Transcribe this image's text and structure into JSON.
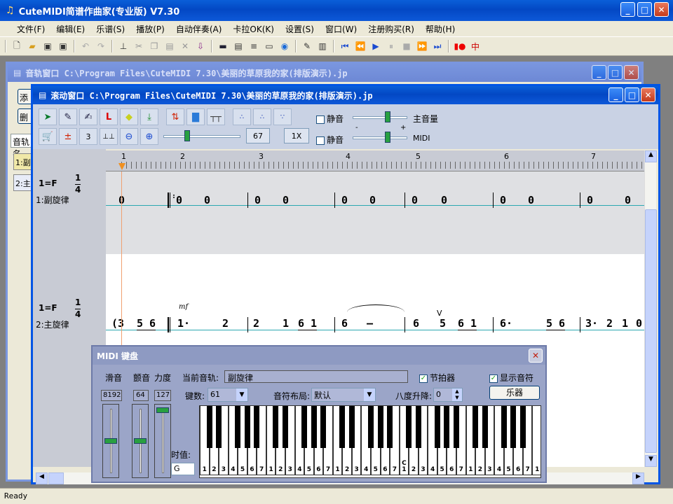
{
  "app": {
    "title": "CuteMIDI简谱作曲家(专业版) V7.30"
  },
  "menu": [
    "文件(F)",
    "编辑(E)",
    "乐谱(S)",
    "播放(P)",
    "自动伴奏(A)",
    "卡拉OK(K)",
    "设置(S)",
    "窗口(W)",
    "注册购买(R)",
    "帮助(H)"
  ],
  "track_window": {
    "title": "音轨窗口  C:\\Program Files\\CuteMIDI 7.30\\美丽的草原我的家(排版演示).jp",
    "tab": "音轨名",
    "buttons": [
      "添",
      "删"
    ],
    "tracks": [
      "1:副",
      "2:主"
    ]
  },
  "scroll_window": {
    "title": "滚动窗口  C:\\Program Files\\CuteMIDI 7.30\\美丽的草原我的家(排版演示).jp",
    "tool_value_3": "3",
    "tempo_value": "67",
    "speed_value": "1X",
    "mute1": "静音",
    "mute2": "静音",
    "master_volume": "主音量",
    "midi_label": "MIDI",
    "minus": "-",
    "plus": "+",
    "ruler": [
      "1",
      "2",
      "3",
      "4",
      "5",
      "6",
      "7"
    ],
    "track1": {
      "key": "1=F",
      "time_top": "1",
      "time_bottom": "4",
      "name": "1:副旋律",
      "notes": [
        "0",
        "0",
        "0",
        "0",
        "0",
        "0",
        "0",
        "0",
        "0",
        "0",
        "0",
        "0",
        "0"
      ]
    },
    "track2": {
      "key": "1=F",
      "time_top": "1",
      "time_bottom": "4",
      "name": "2:主旋律",
      "dynamic": "mf",
      "breath": "V",
      "notes": [
        "(3",
        "5 6",
        "1·",
        "2",
        "2",
        "1",
        "6 1",
        "6",
        "–",
        "6",
        "5",
        "6 1",
        "6·",
        "5 6",
        "3·",
        "2",
        "1",
        "0"
      ]
    }
  },
  "midi_keyboard": {
    "title": "MIDI 键盘",
    "slide_label": "滑音",
    "vibrato_label": "颤音",
    "force_label": "力度",
    "slide_value": "8192",
    "vibrato_value": "64",
    "force_value": "127",
    "current_track_label": "当前音轨:",
    "current_track_value": "副旋律",
    "metronome": "节拍器",
    "show_notes": "显示音符",
    "keys_label": "键数:",
    "keys_value": "61",
    "layout_label": "音符布局:",
    "layout_value": "默认",
    "octave_label": "八度升降:",
    "octave_value": "0",
    "instrument_button": "乐器",
    "duration_label": "时值:",
    "duration_value": "G",
    "key_labels": [
      "1",
      "2",
      "3",
      "4",
      "5",
      "6",
      "7",
      "1",
      "2",
      "3",
      "4",
      "5",
      "6",
      "7",
      "1",
      "2",
      "3",
      "4",
      "5",
      "6",
      "7",
      "C 1",
      "2",
      "3",
      "4",
      "5",
      "6",
      "7",
      "1",
      "2",
      "3",
      "4",
      "5",
      "6",
      "7",
      "1",
      "2",
      "3",
      "4",
      "5",
      "6",
      "7",
      "1",
      "2",
      "3",
      "4",
      "5",
      "6",
      "7",
      "1"
    ]
  },
  "status": {
    "text": "Ready"
  }
}
